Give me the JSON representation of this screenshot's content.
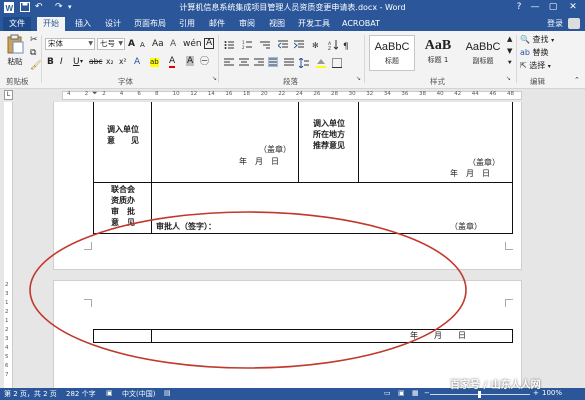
{
  "titlebar": {
    "title": "计算机信息系统集成项目管理人员资质变更申请表.docx - Word",
    "help": "?",
    "minimize": "—",
    "restore": "▢",
    "close": "✕",
    "undo_icon": "↶",
    "redo_icon": "↷"
  },
  "tabs": [
    "文件",
    "开始",
    "插入",
    "设计",
    "页面布局",
    "引用",
    "邮件",
    "审阅",
    "视图",
    "开发工具",
    "ACROBAT"
  ],
  "active_tab": "开始",
  "login": "登录",
  "ribbon": {
    "paste": "粘贴",
    "clipboard_label": "剪贴板",
    "font_name": "宋体",
    "font_size": "七号",
    "font_label": "字体",
    "paragraph_label": "段落",
    "styles_label": "样式",
    "editing_label": "编辑",
    "styles": [
      {
        "sample": "AaBbC",
        "name": "标题"
      },
      {
        "sample": "AaB",
        "name": "标题 1"
      },
      {
        "sample": "AaBbC",
        "name": "副标题"
      }
    ],
    "find": "查找",
    "replace": "替换",
    "select": "选择",
    "bold": "B",
    "italic": "I",
    "underline": "U",
    "strike": "abc",
    "subscript": "x₂",
    "superscript": "x²",
    "grow_font": "A",
    "shrink_font": "A",
    "aa": "Aa",
    "font_color": "A",
    "highlight": "ab",
    "clear_format": "A",
    "char_shade": "A",
    "char_border": "A"
  },
  "ruler": {
    "numbers": [
      "4",
      "2",
      "2",
      "4",
      "6",
      "8",
      "10",
      "12",
      "14",
      "16",
      "18",
      "20",
      "22",
      "24",
      "26",
      "28",
      "30",
      "32",
      "34",
      "36",
      "38",
      "40",
      "42",
      "44",
      "46",
      "48"
    ],
    "vnumbers": [
      "2",
      "3",
      "1",
      "2",
      "1",
      "2",
      "3",
      "4",
      "5",
      "6",
      "7"
    ]
  },
  "document": {
    "row1_label_left": [
      "调入单位",
      "意　　见"
    ],
    "row1_seal_left": "（盖章）",
    "row1_date_left": "年　月　日",
    "row1_label_right": [
      "调入单位",
      "所在地方",
      "推荐意见"
    ],
    "row1_seal_right": "（盖章）",
    "row1_date_right": "年　月　日",
    "row2_label": [
      "联合会",
      "资质办",
      "审　批",
      "意　见"
    ],
    "approver": "审批人（签字）：",
    "row2_seal": "（盖章）",
    "page2_date": "年　　月　　日"
  },
  "statusbar": {
    "page": "第 2 页，共 2 页",
    "words": "282 个字",
    "language": "中文(中国)",
    "zoom": "100%",
    "watermark": "百家号 / 山东人人网"
  },
  "colors": {
    "accent": "#2b579a",
    "annotation": "#c0392b"
  }
}
